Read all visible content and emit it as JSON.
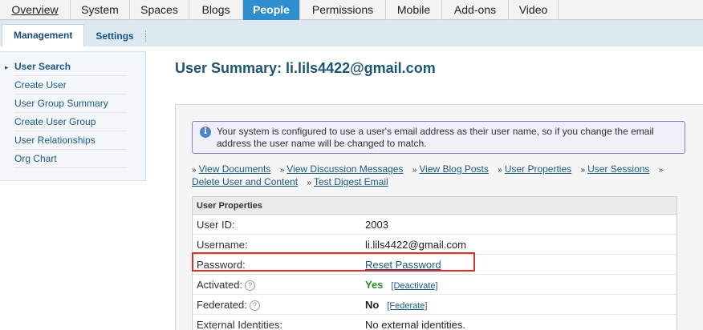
{
  "topnav": {
    "tabs": [
      {
        "label": "Overview"
      },
      {
        "label": "System"
      },
      {
        "label": "Spaces"
      },
      {
        "label": "Blogs"
      },
      {
        "label": "People"
      },
      {
        "label": "Permissions"
      },
      {
        "label": "Mobile"
      },
      {
        "label": "Add-ons"
      },
      {
        "label": "Video"
      }
    ],
    "active": "People"
  },
  "subnav": {
    "tabs": [
      {
        "label": "Management"
      },
      {
        "label": "Settings"
      }
    ]
  },
  "sidebar": {
    "items": [
      {
        "label": "User Search"
      },
      {
        "label": "Create User"
      },
      {
        "label": "User Group Summary"
      },
      {
        "label": "Create User Group"
      },
      {
        "label": "User Relationships"
      },
      {
        "label": "Org Chart"
      }
    ]
  },
  "main": {
    "title": "User Summary: li.lils4422@gmail.com",
    "info": "Your system is configured to use a user's email address as their user name, so if you change the email address the user name will be changed to match.",
    "links": [
      {
        "label": "View Documents"
      },
      {
        "label": "View Discussion Messages"
      },
      {
        "label": "View Blog Posts"
      },
      {
        "label": "User Properties"
      },
      {
        "label": "User Sessions"
      },
      {
        "label": "Delete User and Content"
      },
      {
        "label": "Test Digest Email"
      }
    ],
    "properties": {
      "header": "User Properties",
      "rows": [
        {
          "label": "User ID:",
          "value": "2003"
        },
        {
          "label": "Username:",
          "value": "li.lils4422@gmail.com"
        },
        {
          "label": "Password:",
          "value": "Reset Password"
        },
        {
          "label": "Activated:",
          "value": "Yes",
          "action": "[Deactivate]"
        },
        {
          "label": "Federated:",
          "value": "No",
          "action": "[Federate]"
        },
        {
          "label": "External Identities:",
          "value": "No external identities."
        }
      ]
    }
  },
  "colors": {
    "active_tab": "#2f8ed0",
    "link": "#1b5a86",
    "highlight": "#d9302b",
    "yes": "#2a8a2a"
  }
}
